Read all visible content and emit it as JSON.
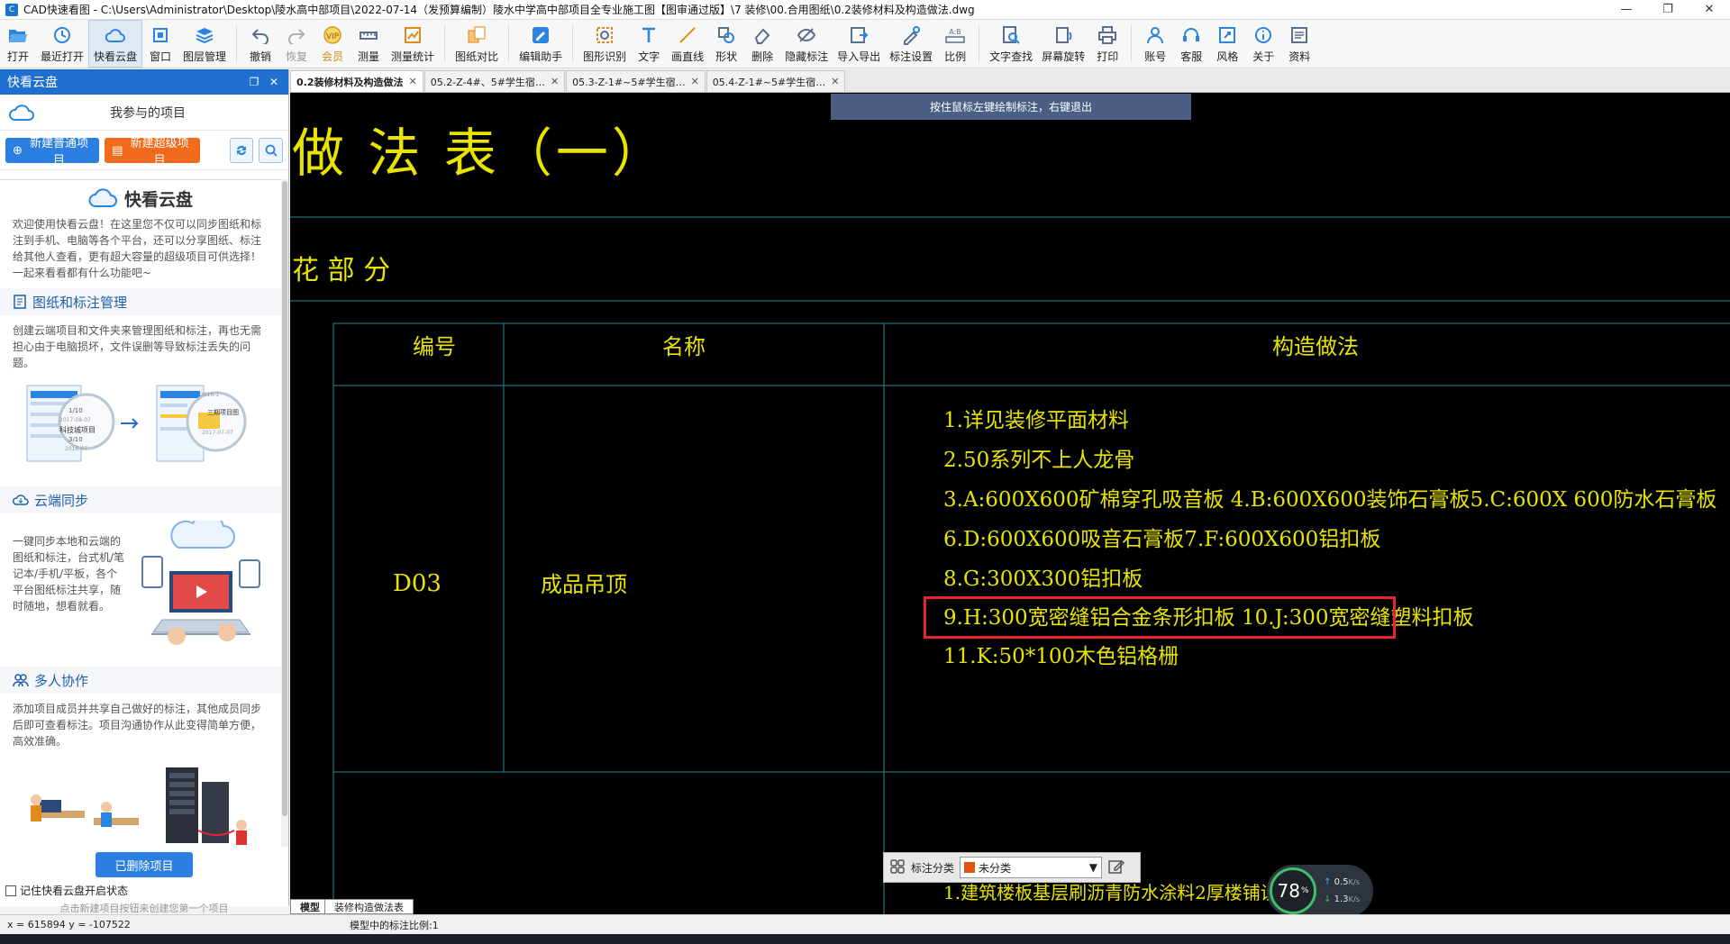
{
  "window": {
    "title": "CAD快速看图 - C:\\Users\\Administrator\\Desktop\\陵水高中部项目\\2022-07-14（发预算编制）陵水中学高中部项目全专业施工图【图审通过版】\\7 装修\\00.合用图纸\\0.2装修材料及构造做法.dwg",
    "minimize": "—",
    "maximize": "❐",
    "close": "✕"
  },
  "toolbar": {
    "open": "打开",
    "recent": "最近打开",
    "cloud": "快看云盘",
    "window": "窗口",
    "layers": "图层管理",
    "undo": "撤销",
    "redo": "恢复",
    "vip": "会员",
    "measure": "测量",
    "measure_stats": "测量统计",
    "compare": "图纸对比",
    "edit_helper": "编辑助手",
    "shape_recog": "图形识别",
    "text": "文字",
    "line": "画直线",
    "shape": "形状",
    "delete": "删除",
    "hide_ann": "隐藏标注",
    "import_export": "导入导出",
    "ann_settings": "标注设置",
    "scale": "比例",
    "text_search": "文字查找",
    "rotate": "屏幕旋转",
    "print": "打印",
    "account": "账号",
    "service": "客服",
    "style": "风格",
    "about": "关于",
    "resources": "资料"
  },
  "left_panel": {
    "header": "快看云盘",
    "project_label": "我参与的项目",
    "new_normal": "新建普通项目",
    "new_super": "新建超级项目",
    "cloud_title": "快看云盘",
    "intro": "欢迎使用快看云盘！在这里您不仅可以同步图纸和标注到手机、电脑等各个平台，还可以分享图纸、标注给其他人查看，更有超大容量的超级项目可供选择！一起来看看都有什么功能吧~",
    "sections": [
      {
        "title": "图纸和标注管理",
        "body": "创建云端项目和文件夹来管理图纸和标注，再也无需担心由于电脑损坏，文件误删等导致标注丢失的问题。"
      },
      {
        "title": "云端同步",
        "body": "一键同步本地和云端的图纸和标注，台式机/笔记本/手机/平板，各个平台图纸标注共享，随时随地，想看就看。"
      },
      {
        "title": "多人协作",
        "body": "添加项目成员并共享自己做好的标注，其他成员同步后即可查看标注。项目沟通协作从此变得简单方便，高效准确。"
      }
    ],
    "illus_text": {
      "a1": "1/10",
      "a2": "2017-08-07",
      "a3": "科技城项目",
      "a4": "3/10",
      "a5": "2016-07",
      "b1": "2016-1",
      "b2": "三期项目图",
      "b3": "2017-07-07"
    },
    "deleted_btn": "已删除项目",
    "remember": "记住快看云盘开启状态",
    "hint": "点击新建项目按钮来创建您第一个项目"
  },
  "tabs": [
    {
      "label": "0.2装修材料及构造做法",
      "active": true
    },
    {
      "label": "05.2-Z-4#、5#学生宿…",
      "active": false
    },
    {
      "label": "05.3-Z-1#~5#学生宿…",
      "active": false
    },
    {
      "label": "05.4-Z-1#~5#学生宿…",
      "active": false
    }
  ],
  "canvas": {
    "hint": "按住鼠标左键绘制标注，右键退出",
    "title": "做 法 表（一）",
    "subtitle": "花 部 分",
    "col_no": "编号",
    "col_name": "名称",
    "col_method": "构造做法",
    "row_code": "D03",
    "row_name": "成品吊顶",
    "items": [
      "1.详见装修平面材料",
      "2.50系列不上人龙骨",
      "3.A:600X600矿棉穿孔吸音板 4.B:600X600装饰石膏板5.C:600X 600防水石膏板",
      "6.D:600X600吸音石膏板7.F:600X600铝扣板",
      "8.G:300X300铝扣板",
      "9.H:300宽密缝铝合金条形扣板 10.J:300宽密缝塑料扣板",
      "11.K:50*100木色铝格栅"
    ],
    "bottom_text": "1.建筑楼板基层刷沥青防水涂料2厚楼铺设固定"
  },
  "annotation_category": {
    "label": "标注分类",
    "value": "未分类"
  },
  "speed_widget": {
    "percent": "78",
    "percent_unit": "%",
    "up": "0.5",
    "down": "1.3",
    "unit": "K/s"
  },
  "layout_tabs": {
    "model": "模型",
    "layout": "装修构造做法表"
  },
  "status": {
    "coords": "x = 615894  y = -107522",
    "scale": "模型中的标注比例:1"
  }
}
